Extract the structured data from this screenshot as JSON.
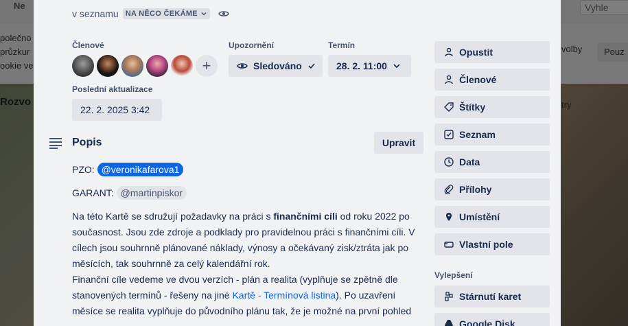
{
  "board": {
    "top_title": "Ne",
    "search_placeholder": "Vyhle",
    "banner_lines": [
      "polečno",
      "průzkur",
      "ookie ve"
    ],
    "banner_pill1": "volby",
    "banner_pill2": "Pouz",
    "list_title": "Rozvo",
    "right_fragment": "try"
  },
  "card": {
    "list_prefix": "v seznamu",
    "list_name": "NA NĚCO ČEKÁME",
    "members_label": "Členové",
    "notifications_label": "Upozornění",
    "notifications_value": "Sledováno",
    "due_label": "Termín",
    "due_value": "28. 2. 11:00",
    "updated_label": "Poslední aktualizace",
    "updated_value": "22. 2. 2025 3:42",
    "members": [
      {
        "name": "member-1",
        "color": "#3a3a3a"
      },
      {
        "name": "member-2",
        "color": "#2b1d16"
      },
      {
        "name": "member-3",
        "color": "#b07a5c"
      },
      {
        "name": "member-4",
        "color": "#c04a8a"
      },
      {
        "name": "member-5",
        "color": "#b84a3a"
      }
    ]
  },
  "description": {
    "title": "Popis",
    "edit_label": "Upravit",
    "pzo_label": "PZO:",
    "pzo_mention": "@veronikafarova1",
    "garant_label": "GARANT:",
    "garant_mention": "@martinpiskor",
    "p1_a": "Na této Kartě se sdružují požadavky na práci s ",
    "p1_b": "finančními cíli",
    "p1_c": " od roku 2022 po současnost. Jsou zde zdroje a podklady pro pravidelnou práci s finančními cíli. V cílech jsou souhrnně plánované náklady, výnosy a očekávaný zisk/ztráta jak po měsících, tak souhrnně za celý kalendářní rok.",
    "p2_a": "Finanční cíle vedeme ve dvou verzích - plán a realita (vyplňuje se zpětně dle stanovených termínů - řešeny na jiné ",
    "p2_link": "Kartě - Termínová listina",
    "p2_b": "). Po uzavření měsíce se realita vyplňuje do původního plánu tak, že je možné na první pohled"
  },
  "sidebar": {
    "buttons": [
      "Opustit",
      "Členové",
      "Štítky",
      "Seznam",
      "Data",
      "Přílohy",
      "Umístění",
      "Vlastní pole"
    ],
    "powerups_label": "Vylepšení",
    "powerups": [
      "Stárnutí karet",
      "Google Disk"
    ]
  }
}
